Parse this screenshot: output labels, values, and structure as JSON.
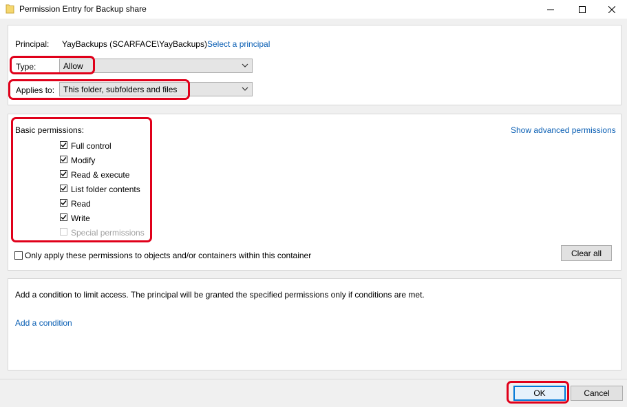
{
  "window": {
    "title": "Permission Entry for Backup share"
  },
  "principal": {
    "label": "Principal:",
    "value": "YayBackups (SCARFACE\\YayBackups)",
    "select_link": "Select a principal"
  },
  "type": {
    "label": "Type:",
    "value": "Allow"
  },
  "applies_to": {
    "label": "Applies to:",
    "value": "This folder, subfolders and files"
  },
  "permissions": {
    "heading": "Basic permissions:",
    "advanced_link": "Show advanced permissions",
    "items": [
      {
        "label": "Full control",
        "checked": true,
        "enabled": true
      },
      {
        "label": "Modify",
        "checked": true,
        "enabled": true
      },
      {
        "label": "Read & execute",
        "checked": true,
        "enabled": true
      },
      {
        "label": "List folder contents",
        "checked": true,
        "enabled": true
      },
      {
        "label": "Read",
        "checked": true,
        "enabled": true
      },
      {
        "label": "Write",
        "checked": true,
        "enabled": true
      },
      {
        "label": "Special permissions",
        "checked": false,
        "enabled": false
      }
    ],
    "only_apply_label": "Only apply these permissions to objects and/or containers within this container",
    "only_apply_checked": false,
    "clear_all": "Clear all"
  },
  "condition": {
    "description": "Add a condition to limit access. The principal will be granted the specified permissions only if conditions are met.",
    "add_link": "Add a condition"
  },
  "footer": {
    "ok": "OK",
    "cancel": "Cancel"
  },
  "colors": {
    "link": "#0a5fb4",
    "annotation": "#e0001a",
    "default_button_border": "#0078d7"
  }
}
